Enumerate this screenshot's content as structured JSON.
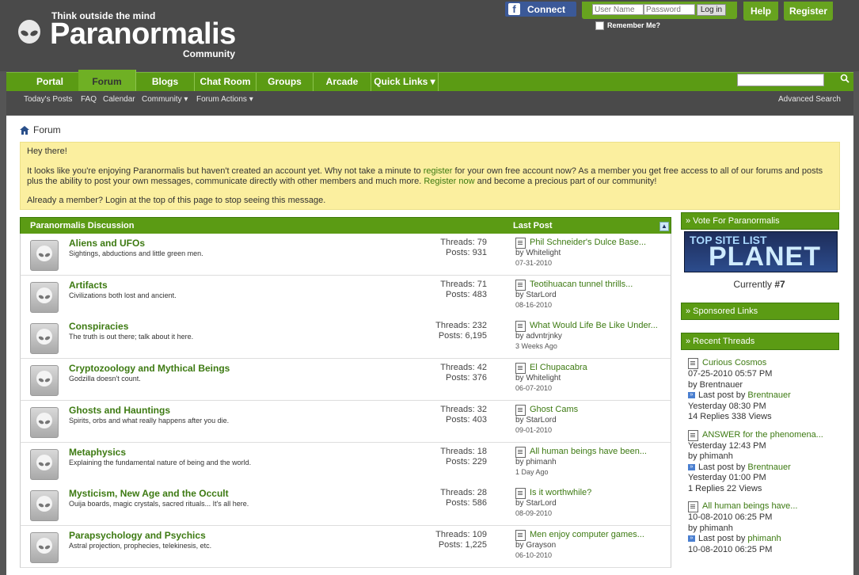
{
  "header": {
    "tagline": "Think outside the mind",
    "brand": "Paranormalis",
    "brand_sub": "Community",
    "facebook_connect": "Connect",
    "login": {
      "username_placeholder": "User Name",
      "password_placeholder": "Password",
      "login_button": "Log in",
      "remember_me": "Remember Me?"
    },
    "help_button": "Help",
    "register_button": "Register"
  },
  "nav": {
    "tabs": [
      "Portal",
      "Forum",
      "Blogs",
      "Chat Room",
      "Groups",
      "Arcade",
      "Quick Links ▾"
    ],
    "active_tab": "Forum",
    "subnav": [
      "Today's Posts",
      "FAQ",
      "Calendar",
      "Community ▾",
      "Forum Actions ▾"
    ],
    "advanced_search": "Advanced Search"
  },
  "breadcrumb": "Forum",
  "notice": {
    "greeting": "Hey there!",
    "line1_pre": "It looks like you're enjoying Paranormalis but haven't created an account yet. Why not take a minute to ",
    "link_register": "register",
    "line1_post": " for your own free account now? As a member you get free access to all of our forums and posts",
    "line2_pre": "plus the ability to post your own messages, communicate directly with other members and much more. ",
    "link_register_now": "Register now",
    "line2_post": " and become a precious part of our community!",
    "already_member": "Already a member? Login at the top of this page to stop seeing this message."
  },
  "forum_table": {
    "heading": "Paranormalis Discussion",
    "last_post_heading": "Last Post",
    "rows": [
      {
        "title": "Aliens and UFOs",
        "desc": "Sightings, abductions and little green men.",
        "threads": "Threads: 79",
        "posts": "Posts: 931",
        "last_title": "Phil Schneider's Dulce Base...",
        "last_by": "by Whitelight",
        "last_date": "07-31-2010"
      },
      {
        "title": "Artifacts",
        "desc": "Civilizations both lost and ancient.",
        "threads": "Threads: 71",
        "posts": "Posts: 483",
        "last_title": "Teotihuacan tunnel thrills...",
        "last_by": "by StarLord",
        "last_date": "08-16-2010"
      },
      {
        "title": "Conspiracies",
        "desc": "The truth is out there; talk about it here.",
        "threads": "Threads: 232",
        "posts": "Posts: 6,195",
        "last_title": "What Would Life Be Like Under...",
        "last_by": "by advntrjnky",
        "last_date": "3 Weeks Ago"
      },
      {
        "title": "Cryptozoology and Mythical Beings",
        "desc": "Godzilla doesn't count.",
        "threads": "Threads: 42",
        "posts": "Posts: 376",
        "last_title": "El Chupacabra",
        "last_by": "by Whitelight",
        "last_date": "06-07-2010"
      },
      {
        "title": "Ghosts and Hauntings",
        "desc": "Spirits, orbs and what really happens after you die.",
        "threads": "Threads: 32",
        "posts": "Posts: 403",
        "last_title": "Ghost Cams",
        "last_by": "by StarLord",
        "last_date": "09-01-2010"
      },
      {
        "title": "Metaphysics",
        "desc": "Explaining the fundamental nature of being and the world.",
        "threads": "Threads: 18",
        "posts": "Posts: 229",
        "last_title": "All human beings have been...",
        "last_by": "by phimanh",
        "last_date": "1 Day Ago"
      },
      {
        "title": "Mysticism, New Age and the Occult",
        "desc": "Ouija boards, magic crystals, sacred rituals... It's all here.",
        "threads": "Threads: 28",
        "posts": "Posts: 586",
        "last_title": "Is it worthwhile?",
        "last_by": "by StarLord",
        "last_date": "08-09-2010"
      },
      {
        "title": "Parapsychology and Psychics",
        "desc": "Astral projection, prophecies, telekinesis, etc.",
        "threads": "Threads: 109",
        "posts": "Posts: 1,225",
        "last_title": "Men enjoy computer games...",
        "last_by": "by Grayson",
        "last_date": "06-10-2010"
      }
    ]
  },
  "sidebar": {
    "vote_heading": "» Vote For Paranormalis",
    "vote_banner_top": "TOP SITE LIST",
    "vote_banner_main": "PLANET",
    "vote_currently": "Currently ",
    "vote_rank": "#7",
    "sponsored_heading": "» Sponsored Links",
    "recent_heading": "» Recent Threads",
    "recent": [
      {
        "title": "Curious Cosmos",
        "date": "07-25-2010 05:57 PM",
        "by": "by Brentnauer",
        "last_by_label": "Last post by ",
        "last_by_user": "Brentnauer",
        "last_time": "Yesterday 08:30 PM",
        "stats": "14 Replies 338 Views"
      },
      {
        "title": "ANSWER for the phenomena...",
        "date": "Yesterday 12:43 PM",
        "by": "by phimanh",
        "last_by_label": "Last post by ",
        "last_by_user": "Brentnauer",
        "last_time": "Yesterday 01:00 PM",
        "stats": "1 Replies 22 Views"
      },
      {
        "title": "All human beings have...",
        "date": "10-08-2010 06:25 PM",
        "by": "by phimanh",
        "last_by_label": "Last post by ",
        "last_by_user": "phimanh",
        "last_time": "10-08-2010 06:25 PM",
        "stats": ""
      }
    ]
  }
}
